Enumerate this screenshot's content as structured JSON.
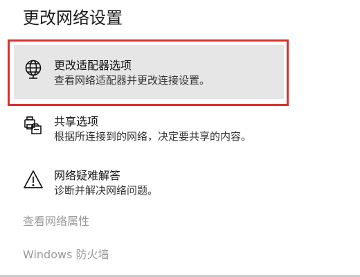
{
  "page": {
    "title": "更改网络设置"
  },
  "options": [
    {
      "icon": "adapter-globe-icon",
      "title": "更改适配器选项",
      "description": "查看网络适配器并更改连接设置。",
      "highlighted": true
    },
    {
      "icon": "sharing-printer-icon",
      "title": "共享选项",
      "description": "根据所连接到的网络，决定要共享的内容。",
      "highlighted": false
    },
    {
      "icon": "warning-triangle-icon",
      "title": "网络疑难解答",
      "description": "诊断并解决网络问题。",
      "highlighted": false
    }
  ],
  "links": {
    "view_properties": "查看网络属性",
    "firewall": "Windows 防火墙"
  },
  "colors": {
    "highlight_border": "#d9302c",
    "highlight_background": "#e6e6e6",
    "link_text": "#9a9a9a"
  }
}
